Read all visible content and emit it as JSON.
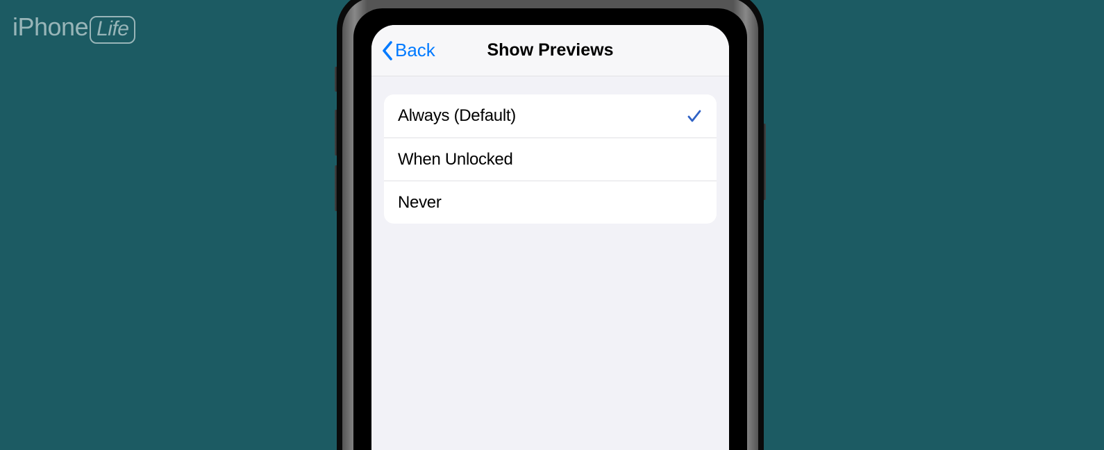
{
  "watermark": {
    "brand_i": "i",
    "brand_phone": "Phone",
    "brand_life": "Life"
  },
  "nav": {
    "back_label": "Back",
    "title": "Show Previews"
  },
  "options": [
    {
      "label": "Always (Default)",
      "selected": true
    },
    {
      "label": "When Unlocked",
      "selected": false
    },
    {
      "label": "Never",
      "selected": false
    }
  ]
}
